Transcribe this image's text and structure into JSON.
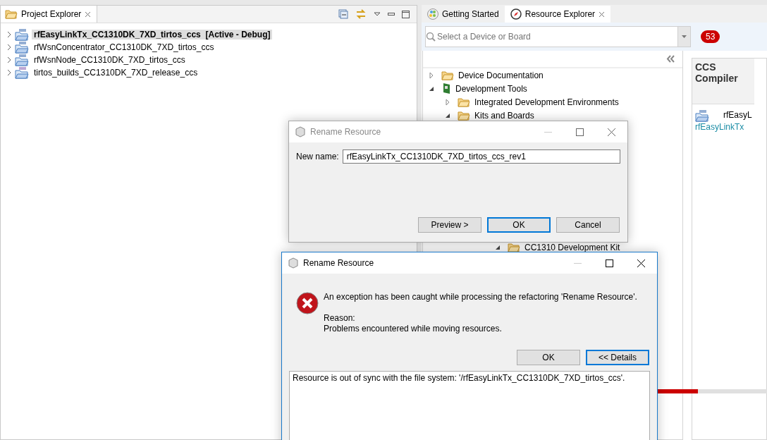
{
  "project_explorer": {
    "title": "Project Explorer",
    "items": [
      {
        "kind": "ccs",
        "name": "rfEasyLinkTx_CC1310DK_7XD_tirtos_ccs",
        "status": "[Active - Debug]",
        "selected": true
      },
      {
        "kind": "ccs",
        "name": "rfWsnConcentrator_CC1310DK_7XD_tirtos_ccs",
        "selected": false
      },
      {
        "kind": "ccs",
        "name": "rfWsnNode_CC1310DK_7XD_tirtos_ccs",
        "selected": false
      },
      {
        "kind": "rtsc",
        "name": "tirtos_builds_CC1310DK_7XD_release_ccs",
        "selected": false
      }
    ]
  },
  "editor_tabs": [
    {
      "label": "Getting Started",
      "selected": false,
      "kind": "start"
    },
    {
      "label": "Resource Explorer",
      "selected": true,
      "kind": "compass"
    }
  ],
  "resource_explorer": {
    "search": {
      "placeholder": "Select a Device or Board"
    },
    "count": "53",
    "tree": [
      {
        "label": "Device Documentation",
        "kind": "folder",
        "expanded": false
      },
      {
        "label": "Development Tools",
        "kind": "board",
        "expanded": true,
        "children": [
          {
            "label": "Integrated Development Environments",
            "kind": "folder",
            "expanded": false
          },
          {
            "label": "Kits and Boards",
            "kind": "folder",
            "expanded": true,
            "children": [
              {
                "label": "CC1310 Development Kit",
                "kind": "package",
                "expanded": true
              }
            ]
          }
        ]
      }
    ],
    "detail": {
      "heading": "CCS Compiler",
      "kind": "ccs",
      "name": "rfEasyL",
      "link": "rfEasyLinkTx"
    },
    "progress": {
      "level": 0.8
    }
  },
  "rename_dialog": {
    "title": "Rename Resource",
    "label": "New name:",
    "value": "rfEasyLinkTx_CC1310DK_7XD_tirtos_ccs_rev1",
    "active": false,
    "buttons": [
      {
        "label": "Preview >",
        "default": false
      },
      {
        "label": "OK",
        "default": true
      },
      {
        "label": "Cancel",
        "default": false
      }
    ]
  },
  "error_dialog": {
    "title": "Rename Resource",
    "active": true,
    "message": "An exception has been caught while processing the refactoring 'Rename Resource'.",
    "reason_label": "Reason:",
    "reason": "Problems encountered while moving resources.",
    "buttons": [
      {
        "label": "OK",
        "default": false
      },
      {
        "label": "<< Details",
        "default": true
      }
    ],
    "details": "Resource is out of sync with the file system: '/rfEasyLinkTx_CC1310DK_7XD_tirtos_ccs'."
  }
}
